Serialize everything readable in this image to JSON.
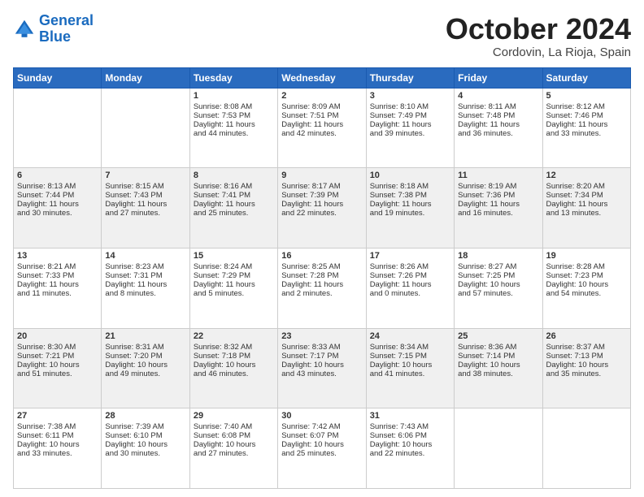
{
  "logo": {
    "line1": "General",
    "line2": "Blue"
  },
  "title": "October 2024",
  "subtitle": "Cordovin, La Rioja, Spain",
  "days_of_week": [
    "Sunday",
    "Monday",
    "Tuesday",
    "Wednesday",
    "Thursday",
    "Friday",
    "Saturday"
  ],
  "weeks": [
    [
      {
        "day": "",
        "lines": []
      },
      {
        "day": "",
        "lines": []
      },
      {
        "day": "1",
        "lines": [
          "Sunrise: 8:08 AM",
          "Sunset: 7:53 PM",
          "Daylight: 11 hours",
          "and 44 minutes."
        ]
      },
      {
        "day": "2",
        "lines": [
          "Sunrise: 8:09 AM",
          "Sunset: 7:51 PM",
          "Daylight: 11 hours",
          "and 42 minutes."
        ]
      },
      {
        "day": "3",
        "lines": [
          "Sunrise: 8:10 AM",
          "Sunset: 7:49 PM",
          "Daylight: 11 hours",
          "and 39 minutes."
        ]
      },
      {
        "day": "4",
        "lines": [
          "Sunrise: 8:11 AM",
          "Sunset: 7:48 PM",
          "Daylight: 11 hours",
          "and 36 minutes."
        ]
      },
      {
        "day": "5",
        "lines": [
          "Sunrise: 8:12 AM",
          "Sunset: 7:46 PM",
          "Daylight: 11 hours",
          "and 33 minutes."
        ]
      }
    ],
    [
      {
        "day": "6",
        "lines": [
          "Sunrise: 8:13 AM",
          "Sunset: 7:44 PM",
          "Daylight: 11 hours",
          "and 30 minutes."
        ]
      },
      {
        "day": "7",
        "lines": [
          "Sunrise: 8:15 AM",
          "Sunset: 7:43 PM",
          "Daylight: 11 hours",
          "and 27 minutes."
        ]
      },
      {
        "day": "8",
        "lines": [
          "Sunrise: 8:16 AM",
          "Sunset: 7:41 PM",
          "Daylight: 11 hours",
          "and 25 minutes."
        ]
      },
      {
        "day": "9",
        "lines": [
          "Sunrise: 8:17 AM",
          "Sunset: 7:39 PM",
          "Daylight: 11 hours",
          "and 22 minutes."
        ]
      },
      {
        "day": "10",
        "lines": [
          "Sunrise: 8:18 AM",
          "Sunset: 7:38 PM",
          "Daylight: 11 hours",
          "and 19 minutes."
        ]
      },
      {
        "day": "11",
        "lines": [
          "Sunrise: 8:19 AM",
          "Sunset: 7:36 PM",
          "Daylight: 11 hours",
          "and 16 minutes."
        ]
      },
      {
        "day": "12",
        "lines": [
          "Sunrise: 8:20 AM",
          "Sunset: 7:34 PM",
          "Daylight: 11 hours",
          "and 13 minutes."
        ]
      }
    ],
    [
      {
        "day": "13",
        "lines": [
          "Sunrise: 8:21 AM",
          "Sunset: 7:33 PM",
          "Daylight: 11 hours",
          "and 11 minutes."
        ]
      },
      {
        "day": "14",
        "lines": [
          "Sunrise: 8:23 AM",
          "Sunset: 7:31 PM",
          "Daylight: 11 hours",
          "and 8 minutes."
        ]
      },
      {
        "day": "15",
        "lines": [
          "Sunrise: 8:24 AM",
          "Sunset: 7:29 PM",
          "Daylight: 11 hours",
          "and 5 minutes."
        ]
      },
      {
        "day": "16",
        "lines": [
          "Sunrise: 8:25 AM",
          "Sunset: 7:28 PM",
          "Daylight: 11 hours",
          "and 2 minutes."
        ]
      },
      {
        "day": "17",
        "lines": [
          "Sunrise: 8:26 AM",
          "Sunset: 7:26 PM",
          "Daylight: 11 hours",
          "and 0 minutes."
        ]
      },
      {
        "day": "18",
        "lines": [
          "Sunrise: 8:27 AM",
          "Sunset: 7:25 PM",
          "Daylight: 10 hours",
          "and 57 minutes."
        ]
      },
      {
        "day": "19",
        "lines": [
          "Sunrise: 8:28 AM",
          "Sunset: 7:23 PM",
          "Daylight: 10 hours",
          "and 54 minutes."
        ]
      }
    ],
    [
      {
        "day": "20",
        "lines": [
          "Sunrise: 8:30 AM",
          "Sunset: 7:21 PM",
          "Daylight: 10 hours",
          "and 51 minutes."
        ]
      },
      {
        "day": "21",
        "lines": [
          "Sunrise: 8:31 AM",
          "Sunset: 7:20 PM",
          "Daylight: 10 hours",
          "and 49 minutes."
        ]
      },
      {
        "day": "22",
        "lines": [
          "Sunrise: 8:32 AM",
          "Sunset: 7:18 PM",
          "Daylight: 10 hours",
          "and 46 minutes."
        ]
      },
      {
        "day": "23",
        "lines": [
          "Sunrise: 8:33 AM",
          "Sunset: 7:17 PM",
          "Daylight: 10 hours",
          "and 43 minutes."
        ]
      },
      {
        "day": "24",
        "lines": [
          "Sunrise: 8:34 AM",
          "Sunset: 7:15 PM",
          "Daylight: 10 hours",
          "and 41 minutes."
        ]
      },
      {
        "day": "25",
        "lines": [
          "Sunrise: 8:36 AM",
          "Sunset: 7:14 PM",
          "Daylight: 10 hours",
          "and 38 minutes."
        ]
      },
      {
        "day": "26",
        "lines": [
          "Sunrise: 8:37 AM",
          "Sunset: 7:13 PM",
          "Daylight: 10 hours",
          "and 35 minutes."
        ]
      }
    ],
    [
      {
        "day": "27",
        "lines": [
          "Sunrise: 7:38 AM",
          "Sunset: 6:11 PM",
          "Daylight: 10 hours",
          "and 33 minutes."
        ]
      },
      {
        "day": "28",
        "lines": [
          "Sunrise: 7:39 AM",
          "Sunset: 6:10 PM",
          "Daylight: 10 hours",
          "and 30 minutes."
        ]
      },
      {
        "day": "29",
        "lines": [
          "Sunrise: 7:40 AM",
          "Sunset: 6:08 PM",
          "Daylight: 10 hours",
          "and 27 minutes."
        ]
      },
      {
        "day": "30",
        "lines": [
          "Sunrise: 7:42 AM",
          "Sunset: 6:07 PM",
          "Daylight: 10 hours",
          "and 25 minutes."
        ]
      },
      {
        "day": "31",
        "lines": [
          "Sunrise: 7:43 AM",
          "Sunset: 6:06 PM",
          "Daylight: 10 hours",
          "and 22 minutes."
        ]
      },
      {
        "day": "",
        "lines": []
      },
      {
        "day": "",
        "lines": []
      }
    ]
  ]
}
